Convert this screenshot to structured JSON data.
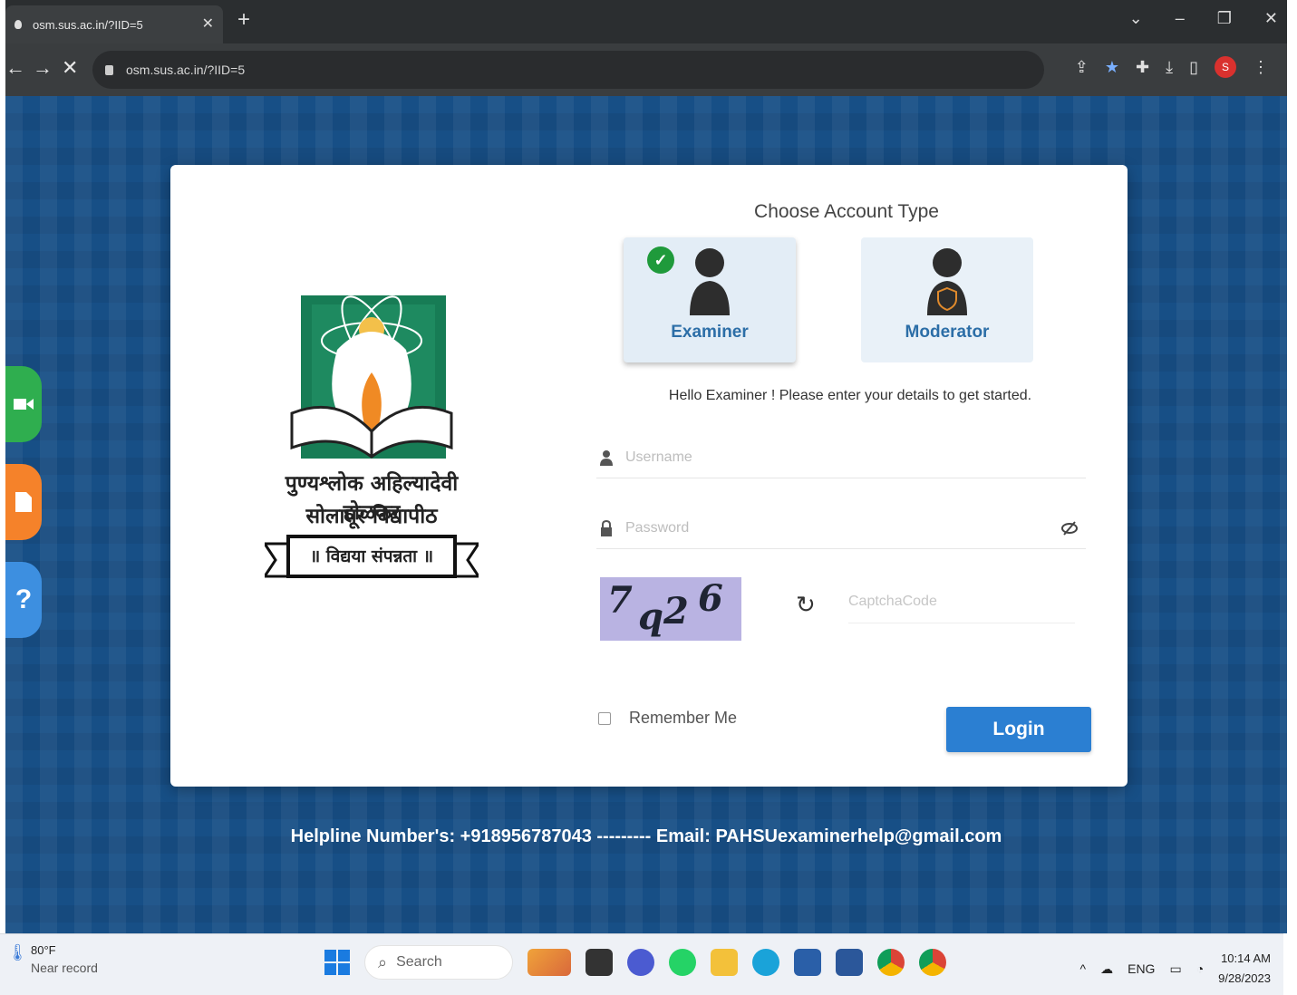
{
  "browser": {
    "tab_title": "osm.sus.ac.in/?IID=5",
    "url": "osm.sus.ac.in/?IID=5",
    "profile_initial": "S"
  },
  "university": {
    "name_line1": "पुण्यश्लोक अहिल्यादेवी होळकर",
    "name_line2": "सोलापूर विद्यापीठ",
    "motto": "॥ विद्यया संपन्नता ॥"
  },
  "login": {
    "choose_title": "Choose Account Type",
    "account_types": [
      {
        "label": "Examiner",
        "selected": true
      },
      {
        "label": "Moderator",
        "selected": false
      }
    ],
    "greeting": "Hello Examiner ! Please enter your details to get started.",
    "username_placeholder": "Username",
    "password_placeholder": "Password",
    "captcha_chars": [
      "7",
      "q",
      "2",
      "6"
    ],
    "captcha_placeholder": "CaptchaCode",
    "remember_label": "Remember Me",
    "login_label": "Login"
  },
  "footer": {
    "helpline": "Helpline Number's: +918956787043 --------- Email: PAHSUexaminerhelp@gmail.com"
  },
  "taskbar": {
    "temperature": "80°F",
    "weather_note": "Near record",
    "search_placeholder": "Search",
    "language": "ENG",
    "time": "10:14 AM",
    "date": "9/28/2023"
  },
  "colors": {
    "page_bg": "#174f86",
    "accent": "#2b7fd2",
    "account_label": "#2c6ea7",
    "check": "#1f9a3b",
    "side_green": "#2fae4f",
    "side_orange": "#f5822a",
    "side_blue": "#3d8fe0"
  }
}
